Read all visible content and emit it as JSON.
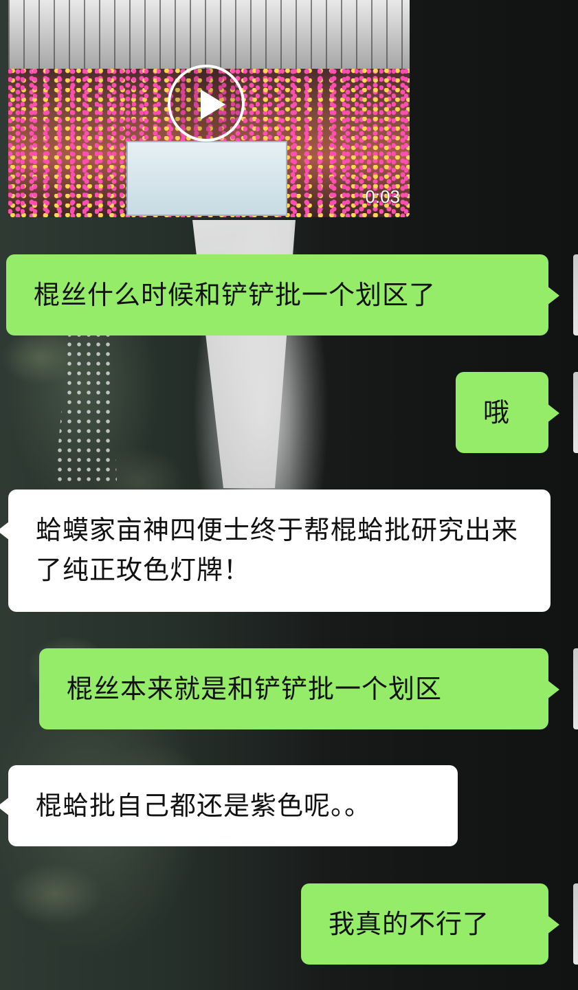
{
  "video": {
    "duration": "0:03",
    "play_icon": "play-icon"
  },
  "messages": [
    {
      "side": "out",
      "text": "棍丝什么时候和铲铲批一个划区了"
    },
    {
      "side": "out",
      "text": "哦"
    },
    {
      "side": "in",
      "text": "蛤蟆家亩神四便士终于帮棍蛤批研究出来了纯正玫色灯牌！"
    },
    {
      "side": "out",
      "text": "棍丝本来就是和铲铲批一个划区"
    },
    {
      "side": "in",
      "text": "棍蛤批自己都还是紫色呢。。"
    },
    {
      "side": "out",
      "text": "我真的不行了"
    }
  ],
  "colors": {
    "outgoing_bubble": "#95ec69",
    "incoming_bubble": "#ffffff"
  }
}
